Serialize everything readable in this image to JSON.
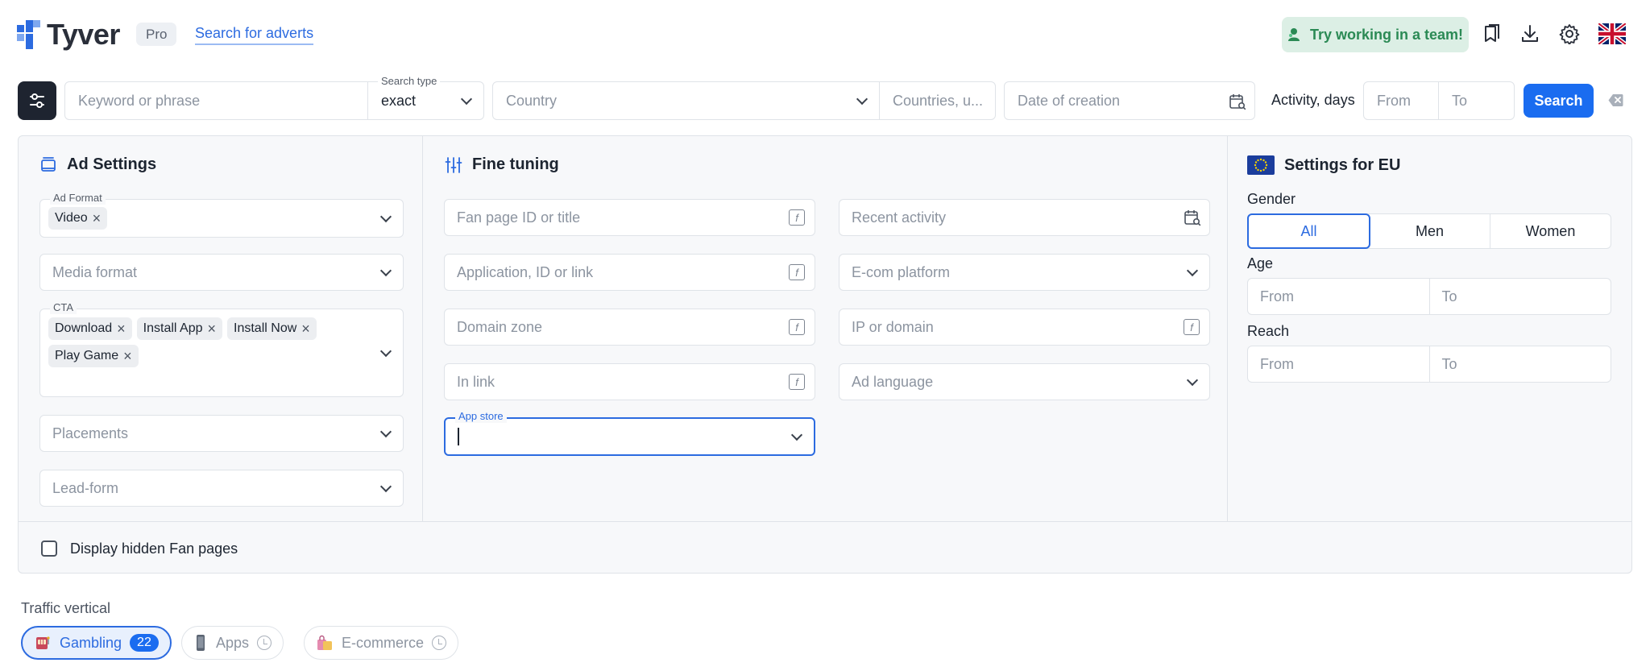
{
  "header": {
    "logo_text": "Tyver",
    "badge": "Pro",
    "nav_link": "Search for adverts",
    "team_button": "Try working in a team!",
    "icons": [
      "bookmarks-icon",
      "download-icon",
      "settings-gear-icon",
      "uk-flag-icon"
    ]
  },
  "search": {
    "keyword_placeholder": "Keyword or phrase",
    "search_type_label": "Search type",
    "search_type_value": "exact",
    "country_placeholder": "Country",
    "countries_placeholder": "Countries, u...",
    "date_placeholder": "Date of creation",
    "activity_label": "Activity, days",
    "from_placeholder": "From",
    "to_placeholder": "To",
    "search_button": "Search"
  },
  "ad_settings": {
    "title": "Ad Settings",
    "ad_format_label": "Ad Format",
    "ad_format_chips": [
      "Video"
    ],
    "media_format_placeholder": "Media format",
    "cta_label": "CTA",
    "cta_chips": [
      "Download",
      "Install App",
      "Install Now",
      "Play Game"
    ],
    "placements_placeholder": "Placements",
    "lead_form_placeholder": "Lead-form"
  },
  "fine_tuning": {
    "title": "Fine tuning",
    "fan_page_placeholder": "Fan page ID or title",
    "application_placeholder": "Application, ID or link",
    "domain_zone_placeholder": "Domain zone",
    "in_link_placeholder": "In link",
    "app_store_label": "App store",
    "recent_activity_placeholder": "Recent activity",
    "ecom_platform_placeholder": "E-com platform",
    "ip_domain_placeholder": "IP or domain",
    "ad_language_placeholder": "Ad language"
  },
  "eu_settings": {
    "title": "Settings for EU",
    "gender_label": "Gender",
    "gender_options": [
      "All",
      "Men",
      "Women"
    ],
    "gender_selected": "All",
    "age_label": "Age",
    "reach_label": "Reach",
    "from_placeholder": "From",
    "to_placeholder": "To"
  },
  "hidden_fan_pages_label": "Display hidden Fan pages",
  "traffic": {
    "label": "Traffic vertical",
    "items": [
      {
        "label": "Gambling",
        "count": "22",
        "active": true
      },
      {
        "label": "Apps"
      },
      {
        "label": "E-commerce"
      }
    ]
  },
  "colors": {
    "accent": "#1a6cf0",
    "dark": "#1e2430",
    "team_bg": "#dcefe5",
    "team_text": "#2b8a55"
  }
}
